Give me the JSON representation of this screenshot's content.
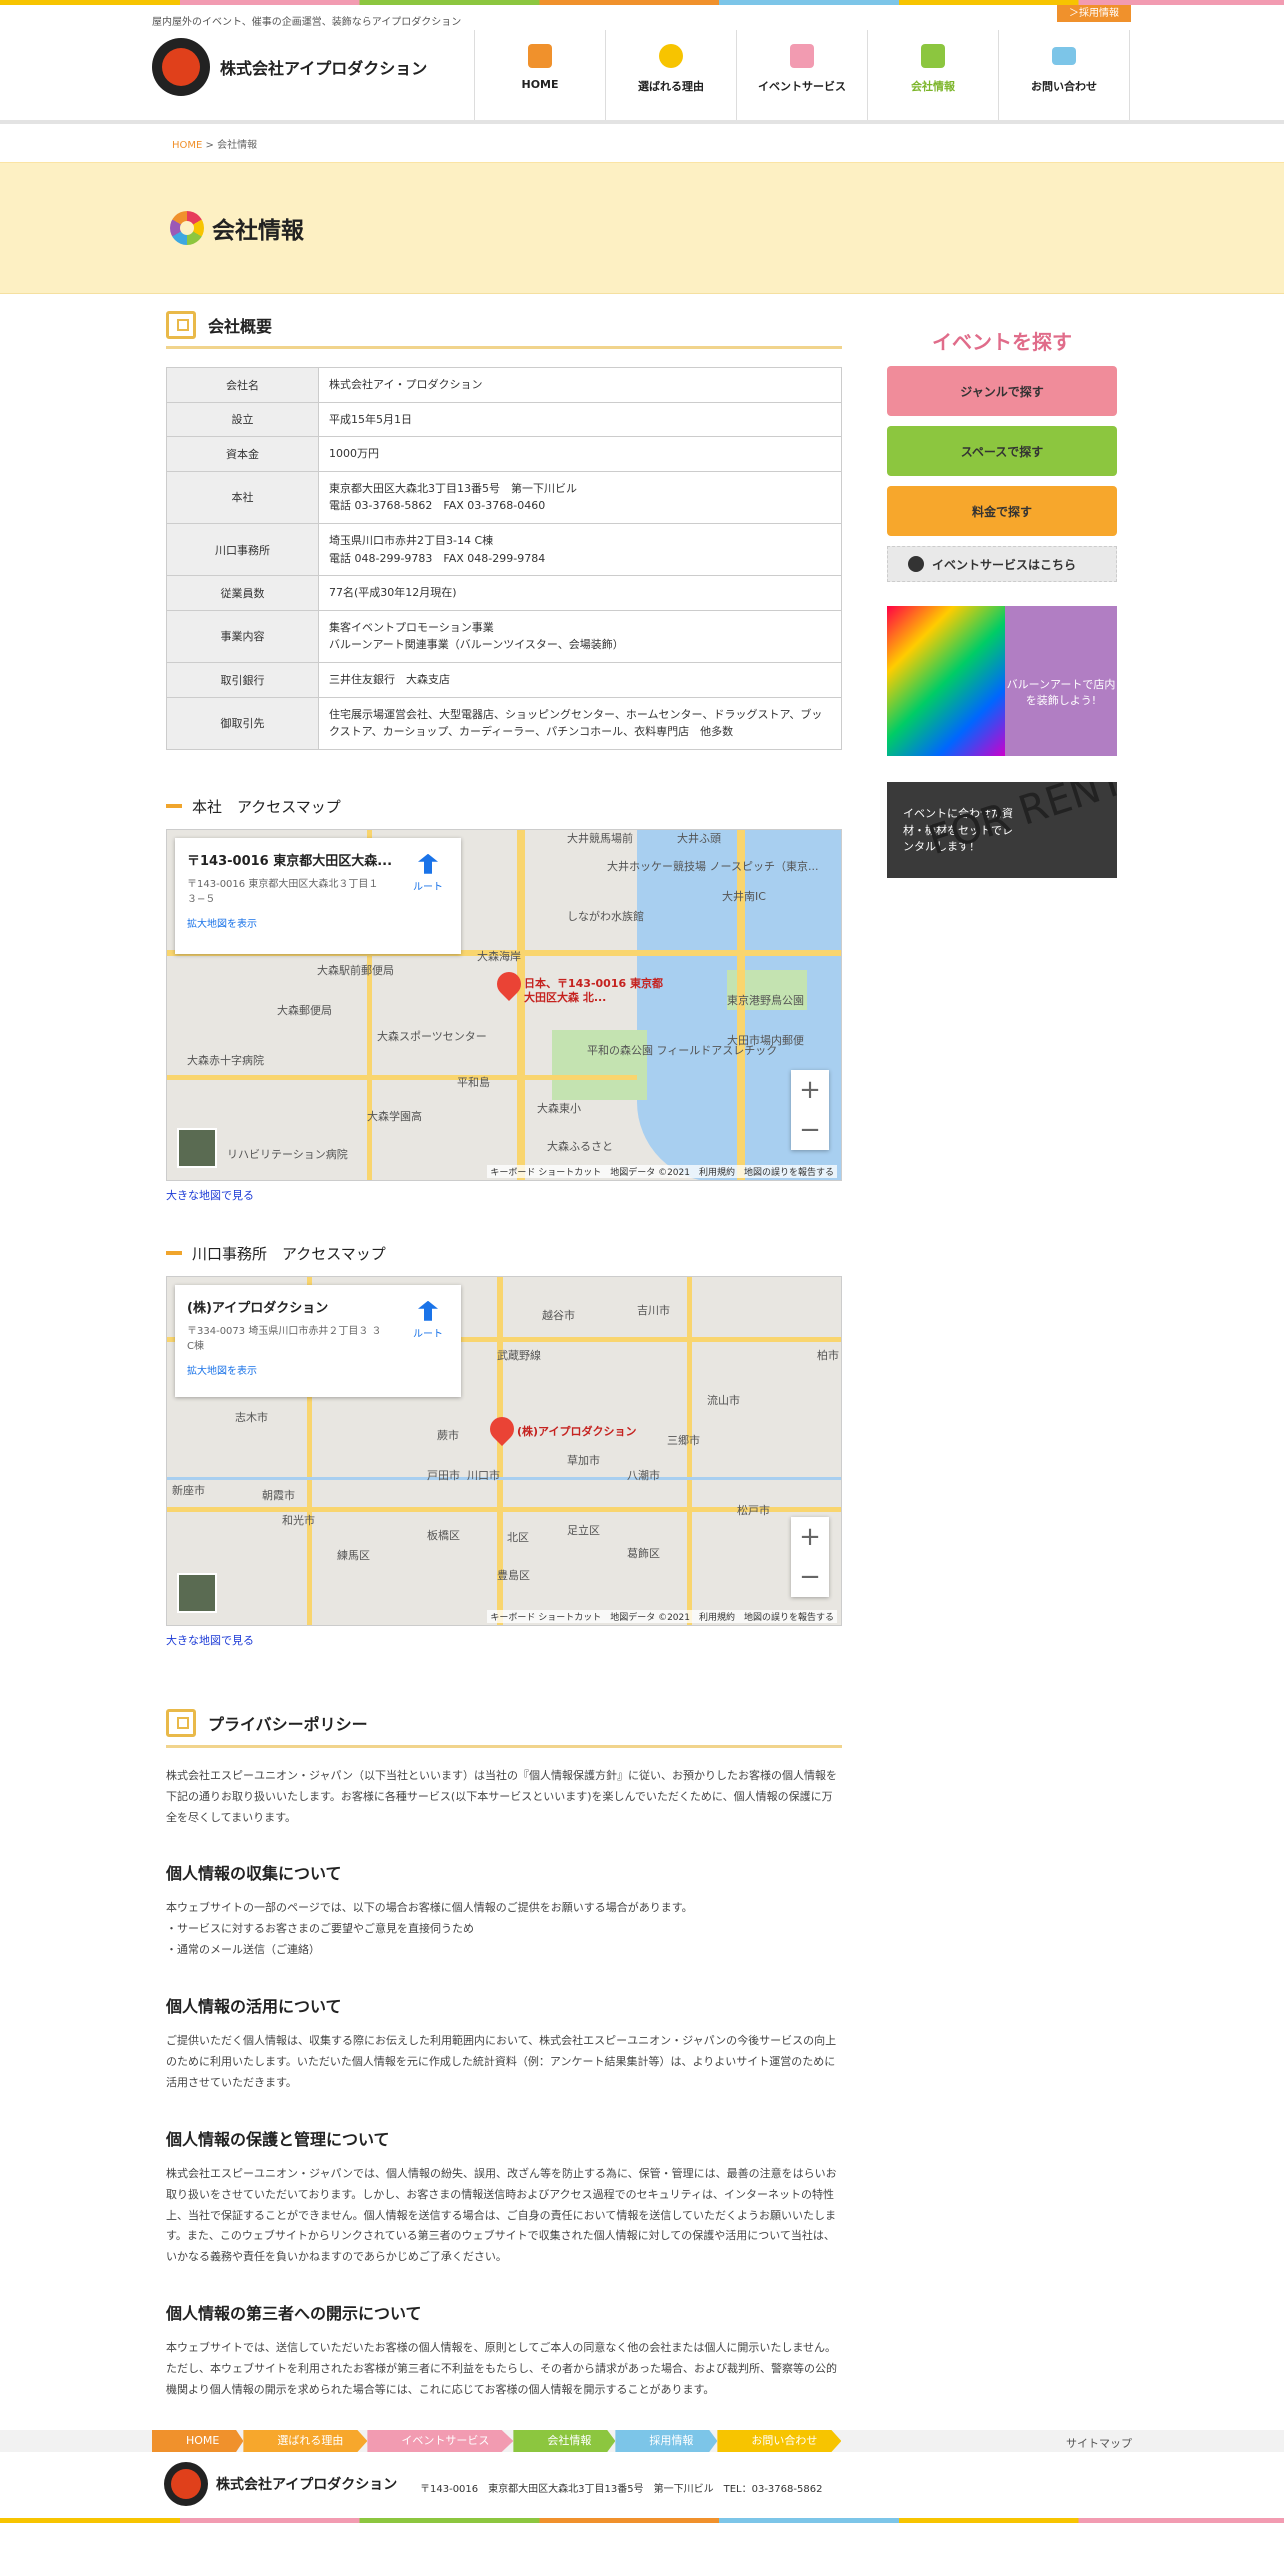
{
  "header": {
    "tagline": "屋内屋外のイベント、催事の企画運営、装飾ならアイプロダクション",
    "recruit_label": "＞採用情報",
    "logo_text": "株式会社アイプロダクション",
    "nav": [
      {
        "label": "HOME",
        "icon": "house-icon",
        "color": "#f0912c"
      },
      {
        "label": "選ばれる理由",
        "icon": "medal-icon",
        "color": "#f7c400"
      },
      {
        "label": "イベントサービス",
        "icon": "gift-icon",
        "color": "#f29bb1"
      },
      {
        "label": "会社情報",
        "icon": "briefcase-icon",
        "color": "#8cc63f"
      },
      {
        "label": "お問い合わせ",
        "icon": "mail-icon",
        "color": "#7cc5e8"
      }
    ]
  },
  "breadcrumb": {
    "home": "HOME",
    "separator": " > ",
    "current": "会社情報"
  },
  "page_title": "会社情報",
  "overview": {
    "heading": "会社概要",
    "rows": [
      {
        "label": "会社名",
        "value": "株式会社アイ・プロダクション"
      },
      {
        "label": "設立",
        "value": "平成15年5月1日"
      },
      {
        "label": "資本金",
        "value": "1000万円"
      },
      {
        "label": "本社",
        "value": "東京都大田区大森北3丁目13番5号　第一下川ビル",
        "value2": "電話 03-3768-5862　FAX 03-3768-0460"
      },
      {
        "label": "川口事務所",
        "value": "埼玉県川口市赤井2丁目3-14 C棟",
        "value2": "電話 048-299-9783　FAX 048-299-9784"
      },
      {
        "label": "従業員数",
        "value": "77名(平成30年12月現在)"
      },
      {
        "label": "事業内容",
        "value": "集客イベントプロモーション事業",
        "value2": "バルーンアート関連事業（バルーンツイスター、会場装飾）"
      },
      {
        "label": "取引銀行",
        "value": "三井住友銀行　大森支店"
      },
      {
        "label": "御取引先",
        "value": "住宅展示場運営会社、大型電器店、ショッピングセンター、ホームセンター、ドラッグストア、ブックストア、カーショップ、カーディーラー、パチンコホール、衣料専門店　他多数"
      }
    ]
  },
  "map1": {
    "heading": "本社　アクセスマップ",
    "card_title": "〒143-0016 東京都大田区大森...",
    "card_address": "〒143-0016 東京都大田区大森北３丁目１３−５",
    "card_link": "拡大地図を表示",
    "route_label": "ルート",
    "pin_label": "日本、〒143-0016 東京都大田区大森 北...",
    "places": [
      "大井競馬場前",
      "大井ホッケー競技場 ノースピッチ（東京...",
      "しながわ水族館",
      "大森駅前郵便局",
      "大森郵便局",
      "大森スポーツセンター",
      "大森赤十字病院",
      "平和の森公園 フィールドアスレチック",
      "大田市場内郵便",
      "東京港野鳥公園",
      "大森東小",
      "大森学園高",
      "平和島",
      "大森海岸",
      "大井南IC",
      "大井ふ頭",
      "大森ふるさと",
      "リハビリテーション病院"
    ],
    "attribution": "キーボード ショートカット　地図データ ©2021　利用規約　地図の誤りを報告する",
    "large_map_link": "大きな地図で見る"
  },
  "map2": {
    "heading": "川口事務所　アクセスマップ",
    "card_title": "(株)アイプロダクション",
    "card_address": "〒334-0073 埼玉県川口市赤井２丁目３ ３C棟",
    "card_link": "拡大地図を表示",
    "route_label": "ルート",
    "pin_label": "(株)アイプロダクション",
    "places": [
      "越谷市",
      "吉川市",
      "武蔵野線",
      "流山市",
      "柏市",
      "志木市",
      "蕨市",
      "草加市",
      "三郷市",
      "新座市",
      "朝霞市",
      "戸田市",
      "川口市",
      "八潮市",
      "和光市",
      "松戸市",
      "足立区",
      "板橋区",
      "北区",
      "葛飾区",
      "練馬区",
      "豊島区"
    ],
    "attribution": "キーボード ショートカット　地図データ ©2021　利用規約　地図の誤りを報告する",
    "large_map_link": "大きな地図で見る"
  },
  "privacy": {
    "heading": "プライバシーポリシー",
    "intro": "株式会社エスピーユニオン・ジャパン（以下当社といいます）は当社の『個人情報保護方針』に従い、お預かりしたお客様の個人情報を下記の通りお取り扱いいたします。お客様に各種サービス(以下本サービスといいます)を楽しんでいただくために、個人情報の保護に万全を尽くしてまいります。",
    "sections": [
      {
        "title": "個人情報の収集について",
        "body": "本ウェブサイトの一部のページでは、以下の場合お客様に個人情報のご提供をお願いする場合があります。\n・サービスに対するお客さまのご要望やご意見を直接伺うため\n・通常のメール送信（ご連絡）"
      },
      {
        "title": "個人情報の活用について",
        "body": "ご提供いただく個人情報は、収集する際にお伝えした利用範囲内において、株式会社エスピーユニオン・ジャパンの今後サービスの向上のために利用いたします。いただいた個人情報を元に作成した統計資料（例：アンケート結果集計等）は、よりよいサイト運営のために活用させていただきます。"
      },
      {
        "title": "個人情報の保護と管理について",
        "body": "株式会社エスピーユニオン・ジャパンでは、個人情報の紛失、誤用、改ざん等を防止する為に、保管・管理には、最善の注意をはらいお取り扱いをさせていただいております。しかし、お客さまの情報送信時およびアクセス過程でのセキュリティは、インターネットの特性上、当社で保証することができません。個人情報を送信する場合は、ご自身の責任において情報を送信していただくようお願いいたします。また、このウェブサイトからリンクされている第三者のウェブサイトで収集された個人情報に対しての保護や活用について当社は、いかなる義務や責任を負いかねますのであらかじめご了承ください。"
      },
      {
        "title": "個人情報の第三者への開示について",
        "body": "本ウェブサイトでは、送信していただいたお客様の個人情報を、原則としてご本人の同意なく他の会社または個人に開示いたしません。ただし、本ウェブサイトを利用されたお客様が第三者に不利益をもたらし、その者から請求があった場合、および裁判所、警察等の公的機関より個人情報の開示を求められた場合等には、これに応じてお客様の個人情報を開示することがあります。"
      }
    ]
  },
  "sidebar": {
    "title": "イベントを探す",
    "buttons": [
      {
        "label": "ジャンルで探す",
        "color": "#f08c9a"
      },
      {
        "label": "スペースで探す",
        "color": "#8cc63f"
      },
      {
        "label": "料金で探す",
        "color": "#f7a72c"
      }
    ],
    "service_link": "イベントサービスはこちら",
    "banner1_text": "バルーンアートで店内を装飾しよう!",
    "banner2_text": "イベントに合わせた資材・機材をセットでレンタルします！",
    "banner2_big": "FOR RENT"
  },
  "footer": {
    "nav": [
      {
        "label": "HOME",
        "color": "#f0912c"
      },
      {
        "label": "選ばれる理由",
        "color": "#f7a72c"
      },
      {
        "label": "イベントサービス",
        "color": "#f29bb1"
      },
      {
        "label": "会社情報",
        "color": "#8cc63f"
      },
      {
        "label": "採用情報",
        "color": "#7cc5e8"
      },
      {
        "label": "お問い合わせ",
        "color": "#f7c400"
      }
    ],
    "sitemap": "サイトマップ",
    "logo_text": "株式会社アイプロダクション",
    "address": "〒143-0016　東京都大田区大森北3丁目13番5号　第一下川ビル　TEL：03-3768-5862"
  }
}
